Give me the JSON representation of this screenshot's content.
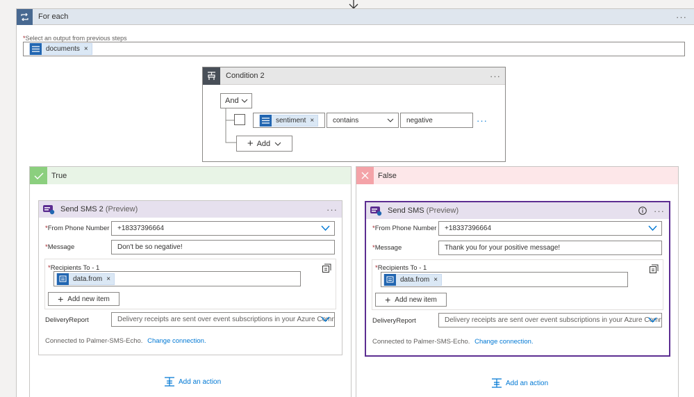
{
  "foreach": {
    "title": "For each",
    "more": "···",
    "select_label": "Select an output from previous steps",
    "token": "documents",
    "token_remove": "×"
  },
  "condition": {
    "title": "Condition 2",
    "more": "···",
    "group_operator": "And",
    "row": {
      "left_token": "sentiment",
      "token_remove": "×",
      "operator": "contains",
      "value": "negative",
      "more": "···"
    },
    "add_label": "Add"
  },
  "branches": {
    "true": {
      "label": "True",
      "card": {
        "title": "Send SMS 2",
        "preview": "(Preview)",
        "more": "···",
        "from_label": "From Phone Number",
        "from_value": "+18337396664",
        "message_label": "Message",
        "message_value": "Don't be so negative!",
        "recipients_label": "Recipients To - 1",
        "recipient_token": "data.from",
        "token_remove": "×",
        "add_item": "Add new item",
        "delivery_label": "DeliveryReport",
        "delivery_value": "Delivery receipts are sent over event subscriptions in your Azure Communic",
        "connected_text": "Connected to Palmer-SMS-Echo.",
        "change_connection": "Change connection."
      },
      "add_action": "Add an action"
    },
    "false": {
      "label": "False",
      "card": {
        "title": "Send SMS",
        "preview": "(Preview)",
        "more": "···",
        "from_label": "From Phone Number",
        "from_value": "+18337396664",
        "message_label": "Message",
        "message_value": "Thank you for your positive message!",
        "recipients_label": "Recipients To - 1",
        "recipient_token": "data.from",
        "token_remove": "×",
        "add_item": "Add new item",
        "delivery_label": "DeliveryReport",
        "delivery_value": "Delivery receipts are sent over event subscriptions in your Azure Communic",
        "connected_text": "Connected to Palmer-SMS-Echo.",
        "change_connection": "Change connection."
      },
      "add_action": "Add an action"
    }
  },
  "colors": {
    "foreach_accent": "#486991",
    "token_blue": "#2266b1",
    "true_green": "#8bcf7e",
    "false_red": "#f4a3a8",
    "card_purple": "#5c2d91",
    "link": "#0078d4"
  }
}
